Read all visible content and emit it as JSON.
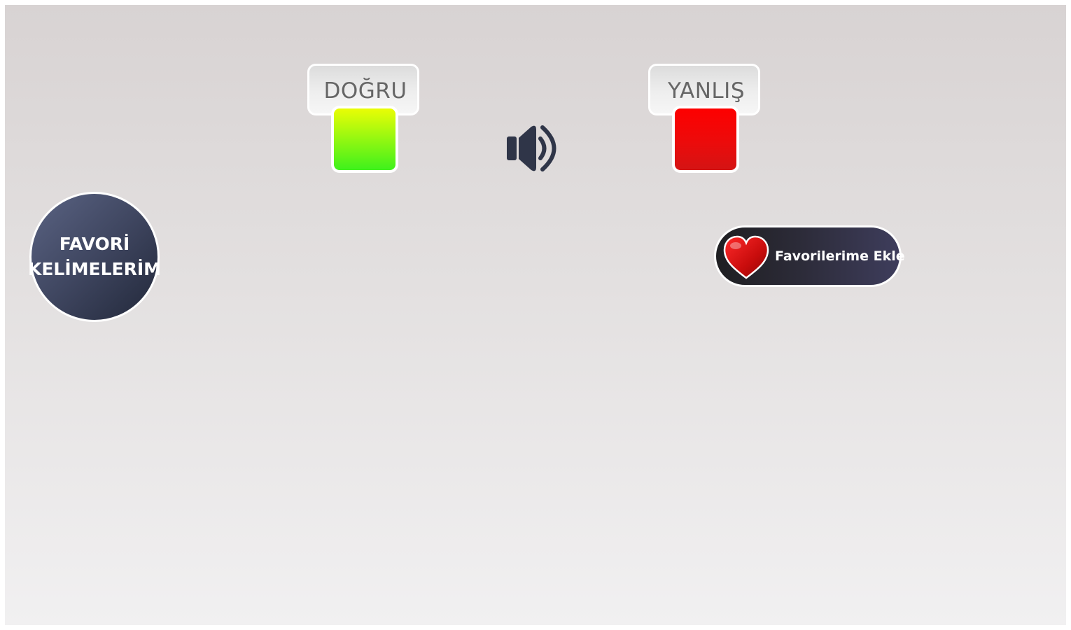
{
  "answers": {
    "correct": {
      "label": "DOĞRU",
      "color": "#4ef216"
    },
    "wrong": {
      "label": "YANLIŞ",
      "color": "#e30a0a"
    }
  },
  "audio": {
    "icon": "speaker-icon"
  },
  "favorites_circle": {
    "line1": "FAVORİ",
    "line2": "KELİMELERİM"
  },
  "add_favorite": {
    "label": "Favorilerime Ekle",
    "icon": "heart-icon"
  },
  "colors": {
    "background_top": "#d8d3d3",
    "background_bottom": "#f1f0f1",
    "dark_button": "#2c2b38",
    "heart": "#c80c0c"
  }
}
